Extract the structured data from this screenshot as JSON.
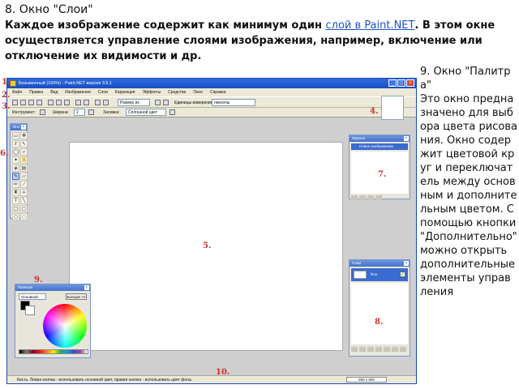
{
  "heading": {
    "title": "8. Окно \"Слои\"",
    "body_before": "Каждое изображение содержит как минимум один ",
    "link_text": "слой в Paint.NET",
    "body_after": ". В этом окне осуществляется  управление слоями изображения, например, включение или отключение их видимости и др."
  },
  "sidebar": {
    "title": "9. Окно \"Палитра\"",
    "text": "Это окно предназначено для выбора цвета рисования. Окно содержит цветовой круг и переключатель между основным и дополнительным цветом. С помощью кнопки \"Дополнительно\" можно открыть дополнительные элементы управления"
  },
  "app": {
    "window_title": "Безымянный (100%) - Paint.NET версия 3.5.1",
    "menu": [
      "Файл",
      "Правка",
      "Вид",
      "Изображения",
      "Слои",
      "Коррекция",
      "Эффекты",
      "Средства",
      "Окно",
      "Справка"
    ],
    "toolbar1": {
      "size_label": "Размер из",
      "units_label": "Единицы измерения:",
      "units_value": "пикселы"
    },
    "toolbar2": {
      "tool_label": "Инструмент:",
      "width_label": "Ширина:",
      "width_value": "2",
      "fill_label": "Заливка:",
      "fill_value": "Сплошной цвет"
    },
    "status_text": "Кисть. Левая кнопка - использовать основной цвет, правая кнопка - использовать цвет фона.",
    "status_size": "800 x 600",
    "panels": {
      "tools_title": "Инс.",
      "history_title": "Журнал",
      "history_item": "Новое изображение",
      "layers_title": "Слои",
      "layer_name": "Фон",
      "palette_title": "Палитра",
      "palette_mode": "Основной",
      "palette_more": "Больше >>"
    }
  },
  "callouts": [
    "1.",
    "2.",
    "3.",
    "4.",
    "5.",
    "6.",
    "7.",
    "8.",
    "9.",
    "10."
  ],
  "colors": {
    "link": "#1a56c4",
    "callout": "#d32f2f",
    "titlebar": "#1a4cc2",
    "selection": "#3a6bd0"
  }
}
